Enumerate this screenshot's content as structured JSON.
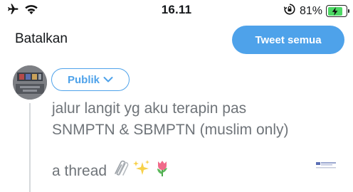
{
  "status_bar": {
    "time": "16.11",
    "battery_percent": "81%",
    "battery_level": 0.81,
    "icons": [
      "airplane-icon",
      "wifi-icon",
      "orientation-lock-icon",
      "battery-icon",
      "charging-bolt-icon"
    ]
  },
  "header": {
    "cancel_label": "Batalkan",
    "tweet_all_label": "Tweet semua"
  },
  "composer": {
    "audience_label": "Publik",
    "text_lines": [
      "jalur langit yg aku terapin pas",
      "SNMPTN & SBMPTN (muslim only)"
    ],
    "thread_line": "a thread",
    "emoji_icons": [
      "paperclips-icon",
      "sparkles-icon",
      "tulip-icon"
    ]
  },
  "colors": {
    "accent": "#4ea2ea",
    "text_muted": "#6f7479",
    "battery": "#4cd964"
  }
}
